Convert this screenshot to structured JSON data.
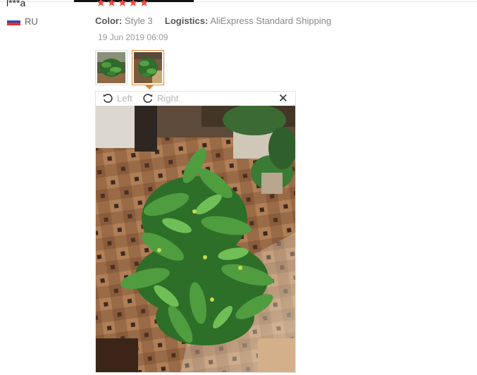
{
  "reviewer": {
    "name": "l***a",
    "country_code": "RU",
    "flag_colors": [
      "#ffffff",
      "#1c4fc2",
      "#e0302f"
    ]
  },
  "rating": {
    "stars": 5,
    "max": 5,
    "color": "#f4433f"
  },
  "meta": {
    "color_label": "Color:",
    "color_value": "Style 3",
    "logistics_label": "Logistics:",
    "logistics_value": "AliExpress Standard Shipping"
  },
  "date": "19 Jun 2019 06:09",
  "thumbnails": [
    {
      "name": "review-photo-1",
      "selected": false
    },
    {
      "name": "review-photo-2",
      "selected": true
    }
  ],
  "viewer": {
    "rotate_left_label": "Left",
    "rotate_right_label": "Right",
    "close_icon": "close-icon",
    "accent_color": "#e5852b"
  }
}
